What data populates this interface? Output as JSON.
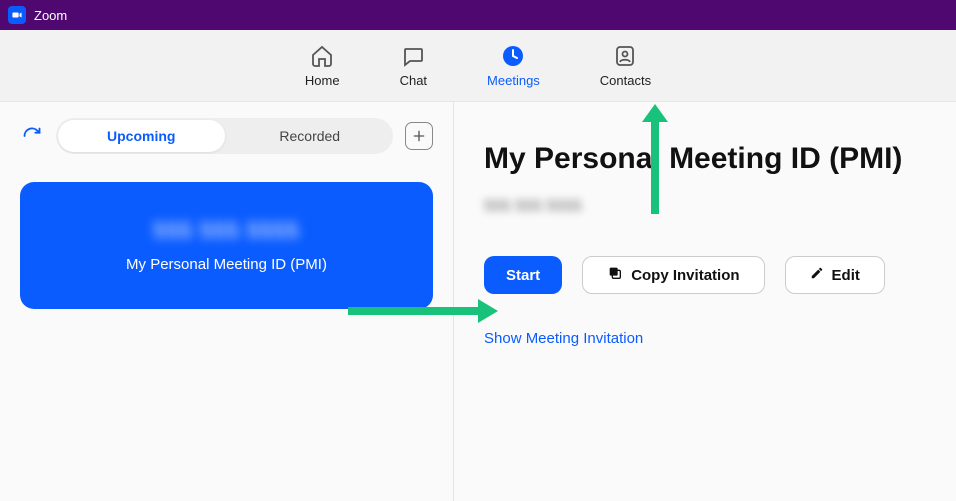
{
  "titlebar": {
    "title": "Zoom"
  },
  "nav": {
    "home": "Home",
    "chat": "Chat",
    "meetings": "Meetings",
    "contacts": "Contacts",
    "active": "meetings"
  },
  "sidebar": {
    "tabs": {
      "upcoming": "Upcoming",
      "recorded": "Recorded",
      "active": "upcoming"
    },
    "card": {
      "pmi_number": "555 555 5555",
      "pmi_label": "My Personal Meeting ID (PMI)"
    }
  },
  "detail": {
    "title": "My Personal Meeting ID (PMI)",
    "pmi_number": "555 555 5555",
    "start_label": "Start",
    "copy_label": "Copy Invitation",
    "edit_label": "Edit",
    "show_link": "Show Meeting Invitation"
  },
  "colors": {
    "accent": "#0b5cff",
    "titlebar": "#4E0870",
    "arrow": "#19c27b"
  }
}
